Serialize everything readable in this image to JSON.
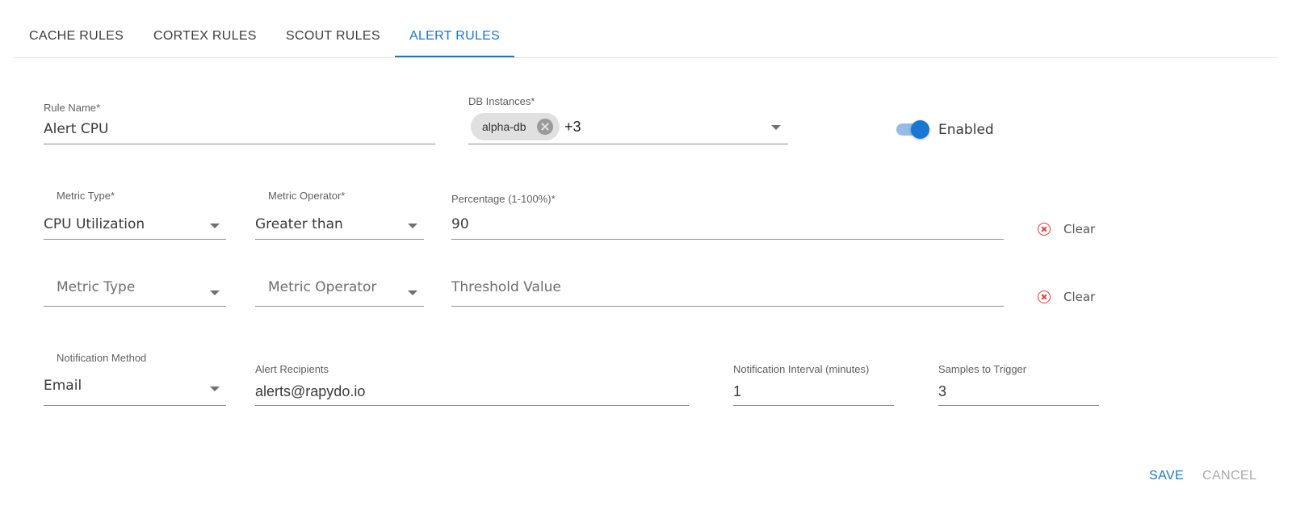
{
  "tabs": [
    {
      "label": "CACHE RULES"
    },
    {
      "label": "CORTEX RULES"
    },
    {
      "label": "SCOUT RULES"
    },
    {
      "label": "ALERT RULES"
    }
  ],
  "active_tab": "ALERT RULES",
  "form": {
    "rule_name": {
      "label": "Rule Name",
      "required_mark": "*",
      "value": "Alert CPU"
    },
    "db_instances": {
      "label": "DB Instances",
      "required_mark": "*",
      "chip": "alpha-db",
      "more_count": "+3"
    },
    "enabled": {
      "label": "Enabled",
      "checked": true
    },
    "condition_1": {
      "metric_type": {
        "label": "Metric Type*",
        "value": "CPU Utilization"
      },
      "metric_operator": {
        "label": "Metric Operator*",
        "value": "Greater than"
      },
      "threshold": {
        "label": "Percentage (1-100%)",
        "required_mark": "*",
        "value": "90"
      },
      "clear_label": "Clear"
    },
    "condition_2": {
      "metric_type": {
        "placeholder": "Metric Type"
      },
      "metric_operator": {
        "placeholder": "Metric Operator"
      },
      "threshold": {
        "placeholder": "Threshold Value"
      },
      "clear_label": "Clear"
    },
    "notification": {
      "method": {
        "label": "Notification Method",
        "value": "Email"
      },
      "recipients": {
        "label": "Alert Recipients",
        "value": "alerts@rapydo.io"
      },
      "interval": {
        "label": "Notification Interval (minutes)",
        "value": "1"
      },
      "samples": {
        "label": "Samples to Trigger",
        "value": "3"
      }
    }
  },
  "actions": {
    "save": "SAVE",
    "cancel": "CANCEL"
  },
  "colors": {
    "accent": "#1976d2",
    "clear": "#e53935",
    "toggle_track": "#93bde8"
  },
  "icons": {
    "chip_delete": "cancel-circle-icon",
    "clear": "cancel-circle-outline-icon",
    "dropdown": "caret-down-icon"
  }
}
